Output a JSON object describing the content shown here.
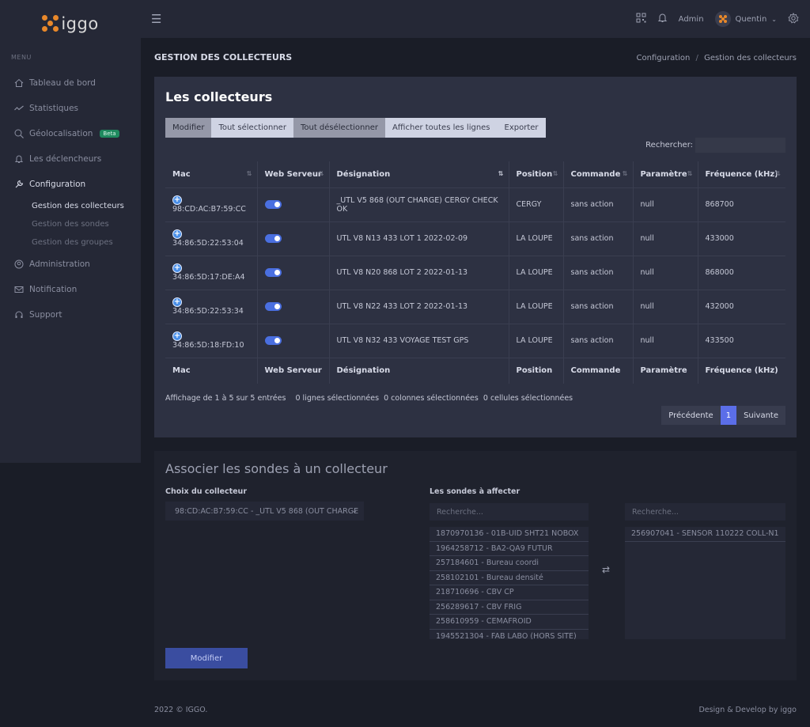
{
  "brand": {
    "name": "iggo"
  },
  "sidebar": {
    "menu_title": "MENU",
    "items": [
      {
        "label": "Tableau de bord",
        "icon": "home-icon"
      },
      {
        "label": "Statistiques",
        "icon": "chart-icon"
      },
      {
        "label": "Géolocalisation",
        "icon": "search-location-icon",
        "badge": "Beta"
      },
      {
        "label": "Les déclencheurs",
        "icon": "bell-icon"
      },
      {
        "label": "Configuration",
        "icon": "wrench-icon"
      },
      {
        "label": "Administration",
        "icon": "user-icon"
      },
      {
        "label": "Notification",
        "icon": "mail-icon"
      },
      {
        "label": "Support",
        "icon": "headset-icon"
      }
    ],
    "config_sub": [
      "Gestion des collecteurs",
      "Gestion des sondes",
      "Gestion des groupes"
    ]
  },
  "topbar": {
    "admin_label": "Admin",
    "user_name": "Quentin"
  },
  "page": {
    "title": "GESTION DES COLLECTEURS",
    "breadcrumb_parent": "Configuration",
    "breadcrumb_sep": "/",
    "breadcrumb_current": "Gestion des collecteurs"
  },
  "collectors": {
    "title": "Les collecteurs",
    "buttons": [
      "Modifier",
      "Tout sélectionner",
      "Tout désélectionner",
      "Afficher toutes les lignes",
      "Exporter"
    ],
    "search_label": "Rechercher:",
    "columns": [
      "Mac",
      "Web Serveur",
      "Désignation",
      "Position",
      "Commande",
      "Paramètre",
      "Fréquence (kHz)"
    ],
    "rows": [
      {
        "mac": "98:CD:AC:B7:59:CC",
        "designation": "_UTL V5 868 (OUT CHARGE) CERGY CHECK OK",
        "position": "CERGY",
        "commande": "sans action",
        "parametre": "null",
        "frequence": "868700"
      },
      {
        "mac": "34:86:5D:22:53:04",
        "designation": "UTL V8 N13 433 LOT 1 2022-02-09",
        "position": "LA LOUPE",
        "commande": "sans action",
        "parametre": "null",
        "frequence": "433000"
      },
      {
        "mac": "34:86:5D:17:DE:A4",
        "designation": "UTL V8 N20 868 LOT 2 2022-01-13",
        "position": "LA LOUPE",
        "commande": "sans action",
        "parametre": "null",
        "frequence": "868000"
      },
      {
        "mac": "34:86:5D:22:53:34",
        "designation": "UTL V8 N22 433 LOT 2 2022-01-13",
        "position": "LA LOUPE",
        "commande": "sans action",
        "parametre": "null",
        "frequence": "432000"
      },
      {
        "mac": "34:86:5D:18:FD:10",
        "designation": "UTL V8 N32 433 VOYAGE TEST GPS",
        "position": "LA LOUPE",
        "commande": "sans action",
        "parametre": "null",
        "frequence": "433500"
      }
    ],
    "info": "Affichage de 1 à 5 sur 5 entrées    0 lignes sélectionnées  0 colonnes sélectionnées  0 cellules sélectionnées",
    "prev": "Précédente",
    "page": "1",
    "next": "Suivante"
  },
  "associate": {
    "title": "Associer les sondes à un collecteur",
    "collector_label": "Choix du collecteur",
    "collector_value": "98:CD:AC:B7:59:CC - _UTL V5 868 (OUT CHARGE",
    "probes_label": "Les sondes à affecter",
    "search_placeholder": "Recherche...",
    "available": [
      "1870970136 - 01B-UID SHT21 NOBOX",
      "1964258712 - BA2-QA9 FUTUR",
      "257184601 - Bureau coordi",
      "258102101 - Bureau densité",
      "218710696 - CBV CP",
      "256289617 - CBV FRIG",
      "258610959 - CEMAFROID",
      "1945521304 - FAB LABO (HORS SITE)"
    ],
    "assigned": [
      "256907041 - SENSOR 110222 COLL-N1"
    ],
    "submit": "Modifier"
  },
  "footer": {
    "left": "2022 © IGGO.",
    "right": "Design & Develop by iggo"
  }
}
